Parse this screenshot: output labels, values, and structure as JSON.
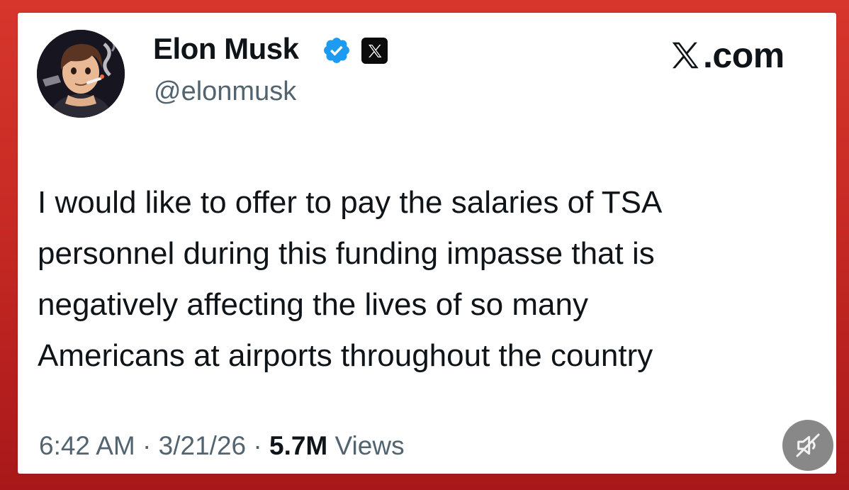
{
  "tweet": {
    "author": {
      "display_name": "Elon Musk",
      "handle": "@elonmusk",
      "verified": true,
      "avatar_icon": "cartoon-avatar-icon"
    },
    "brand": {
      "label": ".com",
      "logo_icon": "x-logo-icon"
    },
    "text_lines": [
      "I would like to offer to pay the salaries of TSA",
      "personnel during this funding impasse that is",
      "negatively affecting the lives of so many",
      "Americans at airports throughout the country"
    ],
    "meta": {
      "time": "6:42 AM",
      "separator": " · ",
      "date": "3/21/26",
      "views_count": "5.7M",
      "views_label": " Views"
    }
  },
  "controls": {
    "mute_icon": "speaker-muted-icon"
  },
  "colors": {
    "frame_red": "#c72a24",
    "verified_blue": "#1d9bf0",
    "text_primary": "#0f1419",
    "text_secondary": "#536471"
  }
}
